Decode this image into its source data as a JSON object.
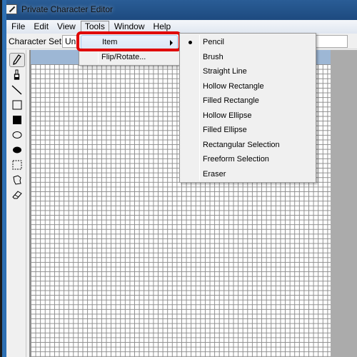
{
  "window": {
    "title": "Private Character Editor"
  },
  "menubar": {
    "items": [
      {
        "label": "File"
      },
      {
        "label": "Edit"
      },
      {
        "label": "View"
      },
      {
        "label": "Tools",
        "active": true
      },
      {
        "label": "Window"
      },
      {
        "label": "Help"
      }
    ]
  },
  "charset": {
    "label": "Character Set:",
    "value": "Unicode"
  },
  "toolbox": {
    "tools": [
      {
        "name": "pencil",
        "icon": "pencil-icon",
        "selected": true
      },
      {
        "name": "brush",
        "icon": "brush-icon"
      },
      {
        "name": "straight-line",
        "icon": "line-icon"
      },
      {
        "name": "hollow-rectangle",
        "icon": "hollow-rectangle-icon"
      },
      {
        "name": "filled-rectangle",
        "icon": "filled-rectangle-icon"
      },
      {
        "name": "hollow-ellipse",
        "icon": "hollow-ellipse-icon"
      },
      {
        "name": "filled-ellipse",
        "icon": "filled-ellipse-icon"
      },
      {
        "name": "rectangular-selection",
        "icon": "rect-selection-icon"
      },
      {
        "name": "freeform-selection",
        "icon": "freeform-selection-icon"
      },
      {
        "name": "eraser",
        "icon": "eraser-icon"
      }
    ]
  },
  "tools_menu": {
    "items": [
      {
        "label": "Item",
        "has_submenu": true,
        "highlighted": true
      },
      {
        "label": "Flip/Rotate..."
      }
    ]
  },
  "item_submenu": {
    "items": [
      {
        "label": "Pencil",
        "checked": true
      },
      {
        "label": "Brush"
      },
      {
        "label": "Straight Line"
      },
      {
        "label": "Hollow Rectangle"
      },
      {
        "label": "Filled Rectangle"
      },
      {
        "label": "Hollow Ellipse"
      },
      {
        "label": "Filled Ellipse"
      },
      {
        "label": "Rectangular Selection"
      },
      {
        "label": "Freeform Selection"
      },
      {
        "label": "Eraser"
      }
    ]
  },
  "annotation": {
    "highlight_color": "#e00000"
  }
}
